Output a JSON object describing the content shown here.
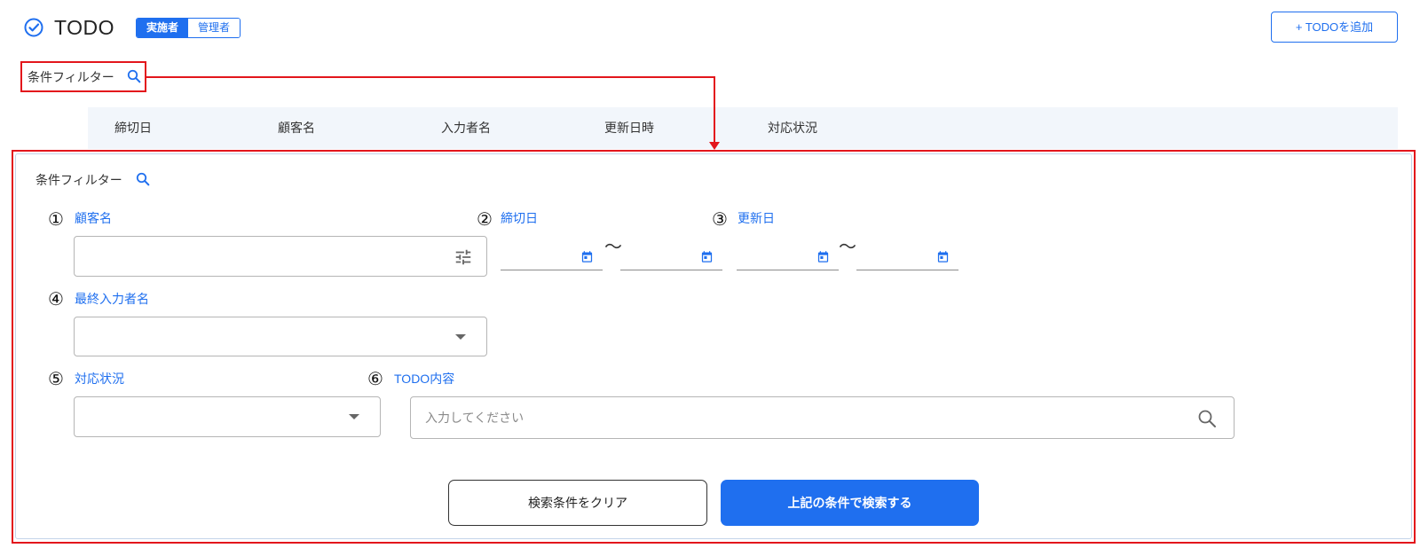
{
  "header": {
    "logo_icon": "check-circle-icon",
    "app_title": "TODO",
    "role_toggle": [
      {
        "label": "実施者",
        "active": true
      },
      {
        "label": "管理者",
        "active": false
      }
    ],
    "add_button_label": "+ TODOを追加"
  },
  "filter_toggle": {
    "label": "条件フィルター",
    "icon": "search-icon"
  },
  "table": {
    "columns": [
      "締切日",
      "顧客名",
      "入力者名",
      "更新日時",
      "対応状況"
    ]
  },
  "filter_panel": {
    "title": "条件フィルター",
    "title_icon": "search-icon",
    "fields": {
      "customer_name": {
        "marker": "①",
        "label": "顧客名",
        "icon": "tune-icon"
      },
      "deadline": {
        "marker": "②",
        "label": "締切日",
        "range_separator": "〜",
        "icon": "calendar-icon"
      },
      "updated_date": {
        "marker": "③",
        "label": "更新日",
        "range_separator": "〜",
        "icon": "calendar-icon"
      },
      "last_inputter_name": {
        "marker": "④",
        "label": "最終入力者名",
        "icon": "caret-down-icon"
      },
      "status": {
        "marker": "⑤",
        "label": "対応状況",
        "icon": "caret-down-icon"
      },
      "todo_content": {
        "marker": "⑥",
        "label": "TODO内容",
        "placeholder": "入力してください",
        "icon": "search-icon"
      }
    },
    "clear_button_label": "検索条件をクリア",
    "search_button_label": "上記の条件で検索する"
  },
  "colors": {
    "accent": "#1f6fef",
    "annotation": "#e3161c",
    "table_header_bg": "#f2f6fb",
    "field_border": "#b5b5b5"
  }
}
